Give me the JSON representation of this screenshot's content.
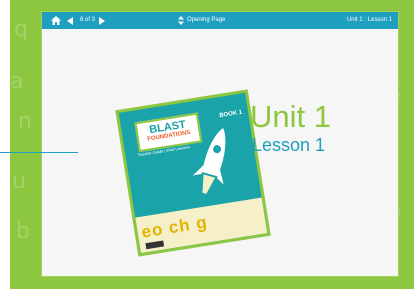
{
  "nav": {
    "home_icon": "home-icon",
    "page_count": "8 of 3",
    "page_name": "Opening Page",
    "unit_crumb": "Unit 1 : Lesson 1"
  },
  "slide": {
    "unit_title": "Unit 1",
    "lesson_title": "Lesson 1"
  },
  "cover": {
    "logo_main": "BLAST",
    "logo_sub": "FOUNDATIONS",
    "subtitle": "Teacher Guide | iPad Lessons",
    "grade": "BOOK 1",
    "letters": "eo ch g"
  },
  "colors": {
    "frame_green": "#8dc63f",
    "nav_blue": "#1f9fbf",
    "cover_teal": "#1aa3a8"
  }
}
